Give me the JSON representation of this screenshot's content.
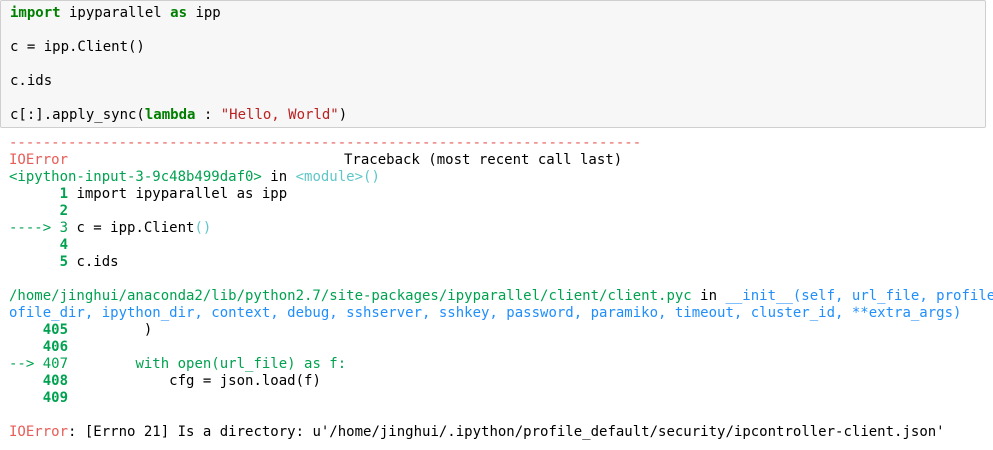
{
  "input_cell": {
    "line1": {
      "kw1": "import",
      "mid": " ipyparallel ",
      "kw2": "as",
      "end": " ipp"
    },
    "line2": "c = ipp.Client()",
    "line3": "c.ids",
    "line4": {
      "pre": "c[:].apply_sync(",
      "kw": "lambda",
      "mid": " : ",
      "str": "\"Hello, World\"",
      "end": ")"
    }
  },
  "output": {
    "separator": "---------------------------------------------------------------------------",
    "error_name": "IOError",
    "traceback_header": "Traceback (most recent call last)",
    "frame1": {
      "file": "<ipython-input-3-9c48b499daf0>",
      "in": " in ",
      "func": "<module>()",
      "lines": [
        {
          "num": "      1",
          "code": " import ipyparallel as ipp"
        },
        {
          "num": "      2",
          "code": ""
        },
        {
          "arrow": "----> 3",
          "code_pre": " c = ipp.Client",
          "code_paren": "()"
        },
        {
          "num": "      4",
          "code": ""
        },
        {
          "num": "      5",
          "code": " c.ids"
        }
      ]
    },
    "frame2": {
      "file": "/home/jinghui/anaconda2/lib/python2.7/site-packages/ipyparallel/client/client.pyc",
      "in": " in ",
      "func_line1": "__init__(self, url_file, profile, pr",
      "func_line2": "ofile_dir, ipython_dir, context, debug, sshserver, sshkey, password, paramiko, timeout, cluster_id, **extra_args)",
      "lines": [
        {
          "num": "    405",
          "code": "         )"
        },
        {
          "num": "    406",
          "code": ""
        },
        {
          "arrow": "--> 407",
          "code": "        with open(url_file) as f:"
        },
        {
          "num": "    408",
          "code": "            cfg = json.load(f)"
        },
        {
          "num": "    409",
          "code": ""
        }
      ]
    },
    "final_error": {
      "name": "IOError",
      "message": ": [Errno 21] Is a directory: u'/home/jinghui/.ipython/profile_default/security/ipcontroller-client.json'"
    }
  },
  "colors": {
    "keyword": "#008000",
    "string": "#ba2121",
    "error": "#e75c58",
    "frame": "#00a250",
    "func": "#60c6c8",
    "path": "#208ffb"
  }
}
